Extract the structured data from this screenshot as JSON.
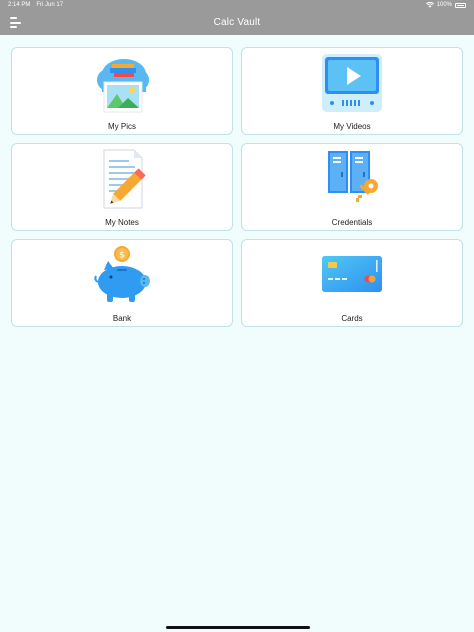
{
  "status_bar": {
    "time": "2:14 PM",
    "date": "Fri Jun 17",
    "battery": "100%"
  },
  "nav": {
    "title": "Calc Vault",
    "menu_icon": "hamburger-menu-icon"
  },
  "tiles": [
    {
      "label": "My Pics",
      "icon": "photos-cloud-icon"
    },
    {
      "label": "My Videos",
      "icon": "video-player-icon"
    },
    {
      "label": "My Notes",
      "icon": "notes-pencil-icon"
    },
    {
      "label": "Credentials",
      "icon": "lockers-key-icon"
    },
    {
      "label": "Bank",
      "icon": "piggy-bank-icon"
    },
    {
      "label": "Cards",
      "icon": "credit-card-icon"
    }
  ],
  "colors": {
    "background": "#f1fdfd",
    "nav_bar": "#9a9a9a",
    "tile_border": "#bfe3e6",
    "accent_blue": "#2f8ff0",
    "accent_orange": "#f7a830"
  }
}
